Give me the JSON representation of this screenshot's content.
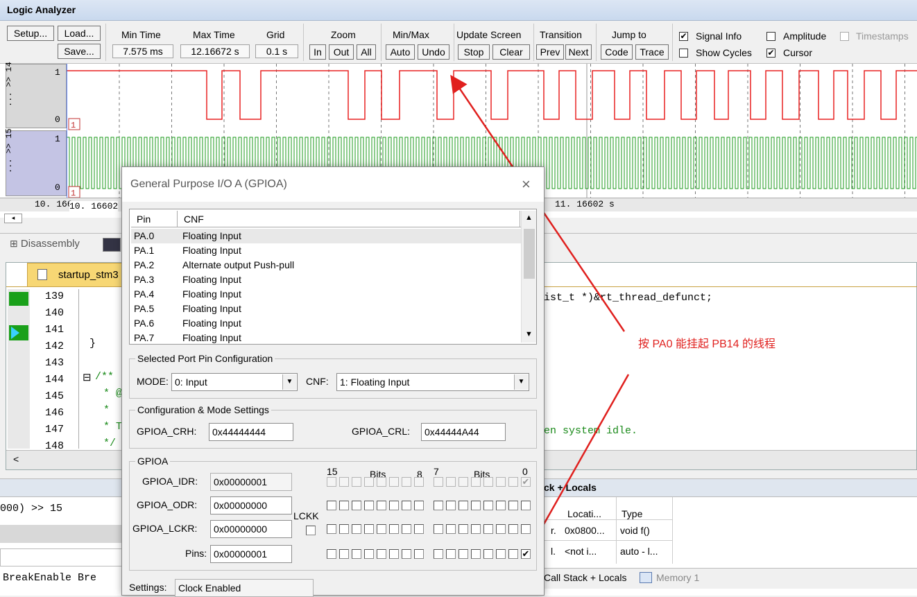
{
  "window": {
    "title": "Logic Analyzer"
  },
  "toolbar": {
    "setup": "Setup...",
    "load": "Load...",
    "save": "Save...",
    "min_time_label": "Min Time",
    "min_time": "7.575 ms",
    "max_time_label": "Max Time",
    "max_time": "12.16672 s",
    "grid_label": "Grid",
    "grid": "0.1 s",
    "zoom_label": "Zoom",
    "zoom_in": "In",
    "zoom_out": "Out",
    "zoom_all": "All",
    "minmax_label": "Min/Max",
    "auto": "Auto",
    "undo": "Undo",
    "update_label": "Update Screen",
    "stop": "Stop",
    "clear": "Clear",
    "transition_label": "Transition",
    "prev": "Prev",
    "next": "Next",
    "jump_label": "Jump to",
    "code": "Code",
    "trace": "Trace",
    "signal_info": "Signal Info",
    "amplitude": "Amplitude",
    "timestamps": "Timestamps",
    "show_cycles": "Show Cycles",
    "cursor": "Cursor"
  },
  "signals": [
    {
      "name": "... >> 14",
      "high": "1",
      "low": "0",
      "marker": "1",
      "color": "#e82020"
    },
    {
      "name": "... >> 15",
      "high": "1",
      "low": "0",
      "marker": "1",
      "color": "#1a9a1a"
    }
  ],
  "timeline": {
    "left_a": "10. 166",
    "left_b": "10. 16602",
    "right": "11. 16602  s"
  },
  "tabs": {
    "disassembly": "Disassembly",
    "file": "startup_stm3",
    "call_stack": "Call Stack + Locals",
    "call_stack_short": "ck + Locals",
    "memory": "Memory 1"
  },
  "code": {
    "line_numbers": [
      "139",
      "140",
      "141",
      "142",
      "143",
      "144",
      "145",
      "146",
      "147",
      "148"
    ],
    "line142": "}",
    "line144": "/**",
    "line145": "* @",
    "line146": "*",
    "line147": "* T",
    "line148": "*/",
    "right139": "ist_t *)&rt_thread_defunct;",
    "right147": "en system idle."
  },
  "bottom": {
    "cmd": "000) >> 15",
    "breakenable": "BreakEnable Bre"
  },
  "locals": {
    "col_location": "Locati...",
    "col_type": "Type",
    "row1_loc": "0x0800...",
    "row1_type": "void f()",
    "row1_pre": "r.",
    "row2_loc": "<not i...",
    "row2_type": "auto - l...",
    "row2_pre": "l."
  },
  "annotation": {
    "text": "按 PA0 能挂起 PB14 的线程",
    "color": "#e0201e"
  },
  "dialog": {
    "title": "General Purpose I/O A (GPIOA)",
    "close": "×",
    "table_headers": [
      "Pin",
      "CNF"
    ],
    "pins": [
      {
        "pin": "PA.0",
        "cnf": "Floating Input"
      },
      {
        "pin": "PA.1",
        "cnf": "Floating Input"
      },
      {
        "pin": "PA.2",
        "cnf": "Alternate output Push-pull"
      },
      {
        "pin": "PA.3",
        "cnf": "Floating Input"
      },
      {
        "pin": "PA.4",
        "cnf": "Floating Input"
      },
      {
        "pin": "PA.5",
        "cnf": "Floating Input"
      },
      {
        "pin": "PA.6",
        "cnf": "Floating Input"
      },
      {
        "pin": "PA.7",
        "cnf": "Floating Input"
      }
    ],
    "selected_group": "Selected Port Pin Configuration",
    "mode_label": "MODE:",
    "mode_value": "0: Input",
    "cnf_label": "CNF:",
    "cnf_value": "1: Floating Input",
    "config_group": "Configuration & Mode Settings",
    "crh_label": "GPIOA_CRH:",
    "crh_value": "0x44444444",
    "crl_label": "GPIOA_CRL:",
    "crl_value": "0x44444A44",
    "gpioa_group": "GPIOA",
    "bits_15": "15",
    "bits_label": "Bits",
    "bits_8": "8",
    "bits_7": "7",
    "bits_0": "0",
    "idr_label": "GPIOA_IDR:",
    "idr_value": "0x00000001",
    "odr_label": "GPIOA_ODR:",
    "odr_value": "0x00000000",
    "lckr_label": "GPIOA_LCKR:",
    "lckr_value": "0x00000000",
    "lckk_label": "LCKK",
    "pins_label": "Pins:",
    "pins_value": "0x00000001",
    "settings_label": "Settings:",
    "settings_value": "Clock Enabled"
  }
}
